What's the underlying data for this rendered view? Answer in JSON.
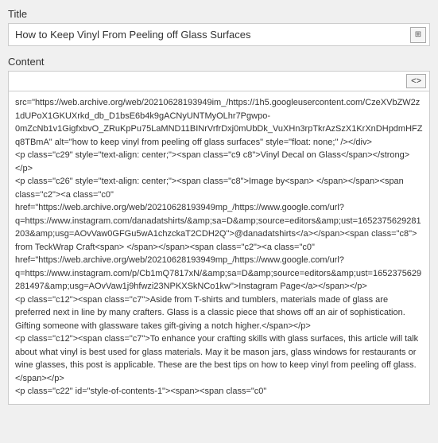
{
  "title_label": "Title",
  "title_value": "How to Keep Vinyl From Peeling off Glass Surfaces",
  "title_icon": "⊞",
  "content_label": "Content",
  "code_toggle_label": "<>",
  "content_value": "src=\"https://web.archive.org/web/20210628193949im_/https://1h5.googleusercontent.com/CzeXVbZW2z1dUPoX1GKUXrkd_db_D1bsE6b4k9gACNyUNTMyOLhr7Pgwpo-0mZcNb1v1GigfxbvO_ZRuKpPu75LaMND11BINrVrfrDxj0mUbDk_VuXHn3rpTkrAzSzX1KrXnDHpdmHFZq8TBmA\" alt=\"how to keep vinyl from peeling off glass surfaces\" style=\"float: none;\" /></div>\n<p class=\"c29\" style=\"text-align: center;\"><span class=\"c9 c8\">Vinyl Decal on Glass</span></strong></p>\n<p class=\"c26\" style=\"text-align: center;\"><span class=\"c8\">Image by<span> </span></span><span class=\"c2\"><a class=\"c0\"\nhref=\"https://web.archive.org/web/20210628193949mp_/https://www.google.com/url?\nq=https://www.instagram.com/danadatshirts/&amp;sa=D&amp;source=editors&amp;ust=1652375629281203&amp;usg=AOvVaw0GFGu5wA1chzckaT2CDH2Q\">@danadatshirts</a></span><span class=\"c8\"> from TeckWrap Craft<span> </span></span><span class=\"c2\"><a class=\"c0\"\nhref=\"https://web.archive.org/web/20210628193949mp_/https://www.google.com/url?\nq=https://www.instagram.com/p/Cb1mQ7817xN/&amp;sa=D&amp;source=editors&amp;ust=1652375629281497&amp;usg=AOvVaw1j9hfwzi23NPKXSkNCo1kw\">Instagram Page</a></span></p>\n<p class=\"c12\"><span class=\"c7\">Aside from T-shirts and tumblers, materials made of glass are preferred next in line by many crafters. Glass is a classic piece that shows off an air of sophistication. Gifting someone with glassware takes gift-giving a notch higher.</span></p>\n<p class=\"c12\"><span class=\"c7\">To enhance your crafting skills with glass surfaces, this article will talk about what vinyl is best used for glass materials. May it be mason jars, glass windows for restaurants or wine glasses, this post is applicable. These are the best tips on how to keep vinyl from peeling off glass.</span></p>\n<p class=\"c22\" id=\"style-of-contents-1\"><span><span class=\"c0\""
}
